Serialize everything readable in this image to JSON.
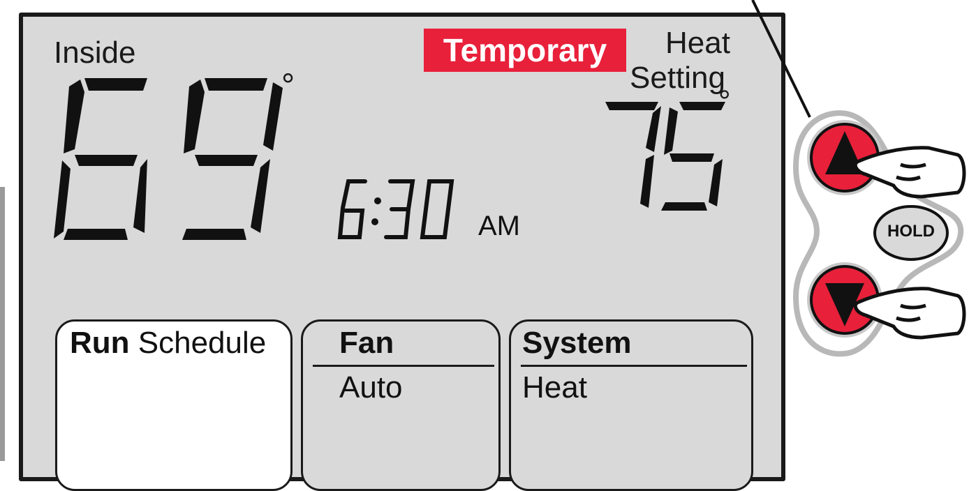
{
  "display": {
    "inside_label": "Inside",
    "inside_temp": "69",
    "degree": "°",
    "temporary_badge": "Temporary",
    "heat_label": "Heat",
    "setting_label": "Setting",
    "set_temp": "75",
    "time": "6:30",
    "ampm": "AM"
  },
  "cards": {
    "run": {
      "bold": "Run",
      "rest": " Schedule"
    },
    "fan": {
      "title": "Fan",
      "value": "Auto"
    },
    "system": {
      "title": "System",
      "value": "Heat"
    }
  },
  "buttons": {
    "up_icon": "up-triangle-icon",
    "down_icon": "down-triangle-icon",
    "hold_label": "HOLD"
  },
  "colors": {
    "lcd_bg": "#d9d9d9",
    "accent_red": "#e8203a",
    "button_ring": "#c8c8c8"
  }
}
